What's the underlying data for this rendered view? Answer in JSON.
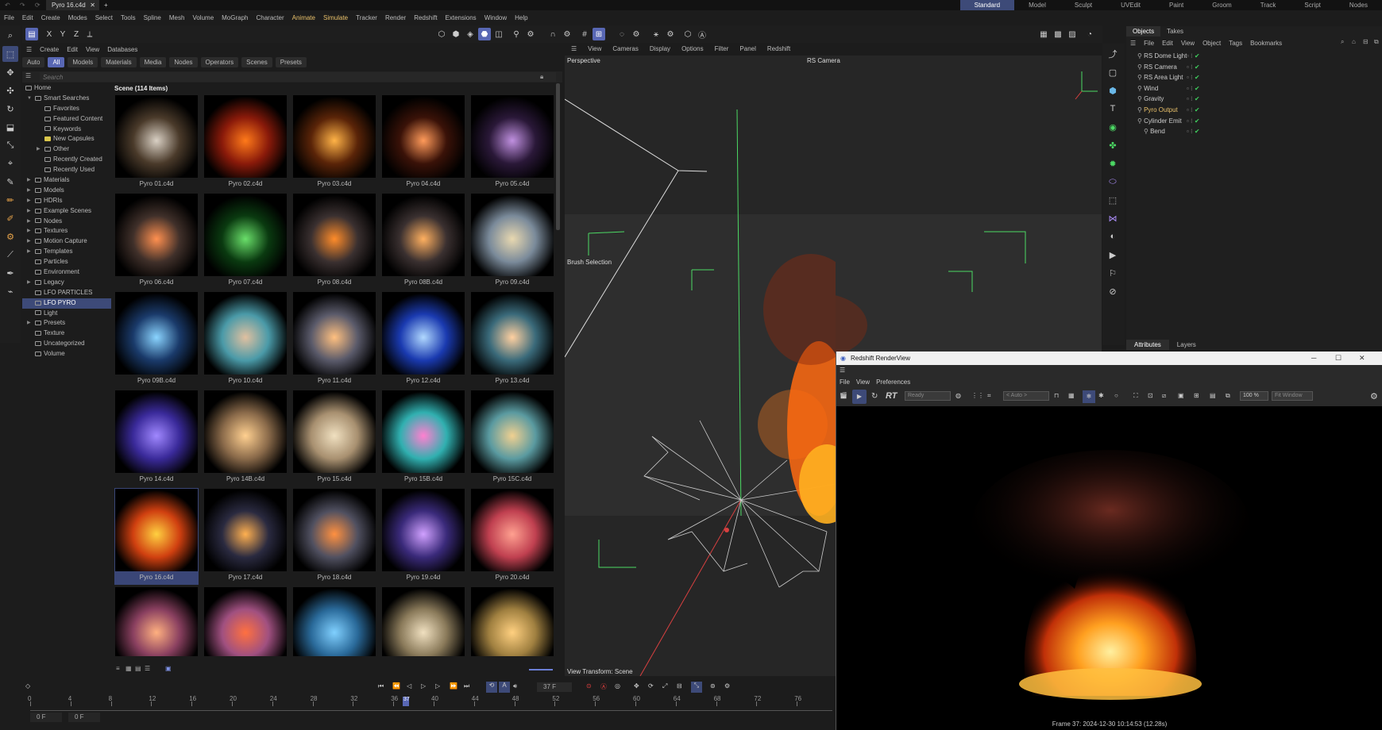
{
  "window": {
    "tab_title": "Pyro 16.c4d",
    "tab_close": "✕",
    "new_tab": "+",
    "nav": "↶ ↷ ⟳"
  },
  "layouts": [
    "Standard",
    "Model",
    "Sculpt",
    "UVEdit",
    "Paint",
    "Groom",
    "Track",
    "Script",
    "Nodes"
  ],
  "menubar": [
    "File",
    "Edit",
    "Create",
    "Modes",
    "Select",
    "Tools",
    "Spline",
    "Mesh",
    "Volume",
    "MoGraph",
    "Character",
    "Animate",
    "Simulate",
    "Tracker",
    "Render",
    "Redshift",
    "Extensions",
    "Window",
    "Help"
  ],
  "axis_toolbar": {
    "x": "X",
    "y": "Y",
    "z": "Z"
  },
  "asset_browser": {
    "menu": [
      "Create",
      "Edit",
      "View",
      "Databases"
    ],
    "filters": [
      "Auto",
      "All",
      "Models",
      "Materials",
      "Media",
      "Nodes",
      "Operators",
      "Scenes",
      "Presets"
    ],
    "search_placeholder": "Search",
    "grid_title": "Scene (114 Items)",
    "tree": [
      {
        "label": "Home",
        "indent": 0,
        "arrow": ""
      },
      {
        "label": "Smart Searches",
        "indent": 1,
        "arrow": "▼"
      },
      {
        "label": "Favorites",
        "indent": 2,
        "arrow": ""
      },
      {
        "label": "Featured Content",
        "indent": 2,
        "arrow": ""
      },
      {
        "label": "Keywords",
        "indent": 2,
        "arrow": ""
      },
      {
        "label": "New Capsules",
        "indent": 2,
        "arrow": ""
      },
      {
        "label": "Other",
        "indent": 2,
        "arrow": "▶"
      },
      {
        "label": "Recently Created",
        "indent": 2,
        "arrow": ""
      },
      {
        "label": "Recently Used",
        "indent": 2,
        "arrow": ""
      },
      {
        "label": "Materials",
        "indent": 1,
        "arrow": "▶"
      },
      {
        "label": "Models",
        "indent": 1,
        "arrow": "▶"
      },
      {
        "label": "HDRIs",
        "indent": 1,
        "arrow": "▶"
      },
      {
        "label": "Example Scenes",
        "indent": 1,
        "arrow": "▶"
      },
      {
        "label": "Nodes",
        "indent": 1,
        "arrow": "▶"
      },
      {
        "label": "Textures",
        "indent": 1,
        "arrow": "▶"
      },
      {
        "label": "Motion Capture",
        "indent": 1,
        "arrow": "▶"
      },
      {
        "label": "Templates",
        "indent": 1,
        "arrow": "▶"
      },
      {
        "label": "Particles",
        "indent": 1,
        "arrow": ""
      },
      {
        "label": "Environment",
        "indent": 1,
        "arrow": ""
      },
      {
        "label": "Legacy",
        "indent": 1,
        "arrow": "▶"
      },
      {
        "label": "LFO PARTICLES",
        "indent": 1,
        "arrow": ""
      },
      {
        "label": "LFO PYRO",
        "indent": 1,
        "arrow": "",
        "selected": true
      },
      {
        "label": "Light",
        "indent": 1,
        "arrow": ""
      },
      {
        "label": "Presets",
        "indent": 1,
        "arrow": "▶"
      },
      {
        "label": "Texture",
        "indent": 1,
        "arrow": ""
      },
      {
        "label": "Uncategorized",
        "indent": 1,
        "arrow": ""
      },
      {
        "label": "Volume",
        "indent": 1,
        "arrow": ""
      }
    ],
    "thumbnails": [
      {
        "label": "Pyro 01.c4d",
        "c1": "#d9d0c4",
        "c2": "#4a3a2a"
      },
      {
        "label": "Pyro 02.c4d",
        "c1": "#ff7a1a",
        "c2": "#8a1a0a"
      },
      {
        "label": "Pyro 03.c4d",
        "c1": "#ffb347",
        "c2": "#5a2408"
      },
      {
        "label": "Pyro 04.c4d",
        "c1": "#ff9a5a",
        "c2": "#3a1208"
      },
      {
        "label": "Pyro 05.c4d",
        "c1": "#c090e0",
        "c2": "#2a1838"
      },
      {
        "label": "Pyro 06.c4d",
        "c1": "#ff9050",
        "c2": "#40302a"
      },
      {
        "label": "Pyro 07.c4d",
        "c1": "#6adf6a",
        "c2": "#0a3a10"
      },
      {
        "label": "Pyro 08.c4d",
        "c1": "#ff8c2a",
        "c2": "#3a3030"
      },
      {
        "label": "Pyro 08B.c4d",
        "c1": "#ffb060",
        "c2": "#3a3030"
      },
      {
        "label": "Pyro 09.c4d",
        "c1": "#e8d8b0",
        "c2": "#7a8a9a"
      },
      {
        "label": "Pyro 09B.c4d",
        "c1": "#8ad4ff",
        "c2": "#1a3a6a"
      },
      {
        "label": "Pyro 10.c4d",
        "c1": "#e0c0a0",
        "c2": "#4a9aa8"
      },
      {
        "label": "Pyro 11.c4d",
        "c1": "#ffc080",
        "c2": "#5a5a6a"
      },
      {
        "label": "Pyro 12.c4d",
        "c1": "#b0d8ff",
        "c2": "#1a3ab0"
      },
      {
        "label": "Pyro 13.c4d",
        "c1": "#ffd0a0",
        "c2": "#3a6a7a"
      },
      {
        "label": "Pyro 14.c4d",
        "c1": "#a088ff",
        "c2": "#3a2a9a"
      },
      {
        "label": "Pyro 14B.c4d",
        "c1": "#ffd090",
        "c2": "#8a6a4a"
      },
      {
        "label": "Pyro 15.c4d",
        "c1": "#f0e0c0",
        "c2": "#a89070"
      },
      {
        "label": "Pyro 15B.c4d",
        "c1": "#ff80d0",
        "c2": "#30b0b0"
      },
      {
        "label": "Pyro 15C.c4d",
        "c1": "#f0d090",
        "c2": "#5a9aa0"
      },
      {
        "label": "Pyro 16.c4d",
        "c1": "#ffd040",
        "c2": "#d04010",
        "selected": true
      },
      {
        "label": "Pyro 17.c4d",
        "c1": "#ffb050",
        "c2": "#2a2a40"
      },
      {
        "label": "Pyro 18.c4d",
        "c1": "#ff9040",
        "c2": "#505060"
      },
      {
        "label": "Pyro 19.c4d",
        "c1": "#d0a0ff",
        "c2": "#3a2a7a"
      },
      {
        "label": "Pyro 20.c4d",
        "c1": "#ffa090",
        "c2": "#c04050"
      },
      {
        "label": "",
        "c1": "#ffb080",
        "c2": "#8a4060"
      },
      {
        "label": "",
        "c1": "#ff7040",
        "c2": "#a05080"
      },
      {
        "label": "",
        "c1": "#80d0ff",
        "c2": "#2a6a9a"
      },
      {
        "label": "",
        "c1": "#f0e0c0",
        "c2": "#8a7a5a"
      },
      {
        "label": "",
        "c1": "#ffd080",
        "c2": "#a08040"
      }
    ]
  },
  "viewport": {
    "menu": [
      "View",
      "Cameras",
      "Display",
      "Options",
      "Filter",
      "Panel",
      "Redshift"
    ],
    "label": "Perspective",
    "camera": "RS Camera",
    "brush_selection": "Brush Selection",
    "view_transform": "View Transform: Scene"
  },
  "objects": {
    "tabs": [
      "Objects",
      "Takes"
    ],
    "menu": [
      "File",
      "Edit",
      "View",
      "Object",
      "Tags",
      "Bookmarks"
    ],
    "items": [
      {
        "name": "RS Dome Light",
        "indent": 0,
        "highlight": false
      },
      {
        "name": "RS Camera",
        "indent": 0,
        "highlight": false
      },
      {
        "name": "RS Area Light",
        "indent": 0,
        "highlight": false
      },
      {
        "name": "Wind",
        "indent": 0,
        "highlight": false
      },
      {
        "name": "Gravity",
        "indent": 0,
        "highlight": false
      },
      {
        "name": "Pyro Output",
        "indent": 0,
        "highlight": true
      },
      {
        "name": "Cylinder Emit",
        "indent": 0,
        "highlight": false
      },
      {
        "name": "Bend",
        "indent": 1,
        "highlight": false
      }
    ],
    "attr_tabs": [
      "Attributes",
      "Layers"
    ]
  },
  "renderview": {
    "title": "Redshift RenderView",
    "menu": [
      "File",
      "View",
      "Preferences"
    ],
    "rt_label": "RT",
    "status_dd": "Ready",
    "aov_dd": "< Auto >",
    "zoom": "100 %",
    "fit_dd": "Fit Window",
    "status": "Frame 37: 2024-12-30 10:14:53 (12.28s)"
  },
  "timeline": {
    "current_frame": "37 F",
    "start_frame": "0 F",
    "offset_frame": "0 F",
    "playhead": "37",
    "ticks": [
      "0",
      "4",
      "8",
      "12",
      "16",
      "20",
      "24",
      "28",
      "32",
      "36",
      "40",
      "44",
      "48",
      "52",
      "56",
      "60",
      "64",
      "68",
      "72",
      "76"
    ]
  }
}
